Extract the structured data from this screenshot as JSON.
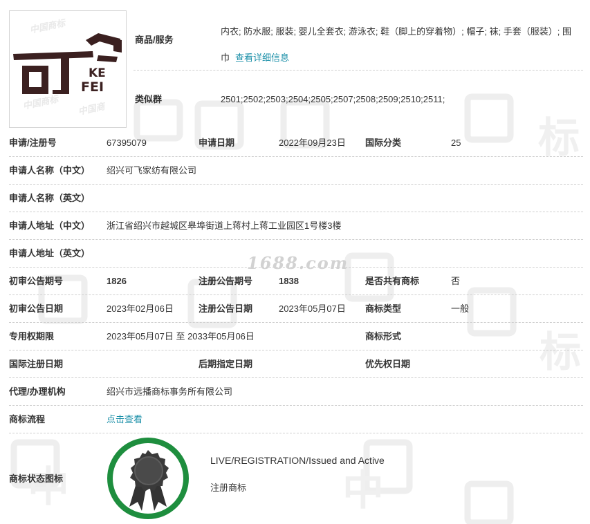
{
  "logo": {
    "icon": "trademark-logo-image",
    "text_top": "KE",
    "text_bottom": "FEI"
  },
  "goods": {
    "label": "商品/服务",
    "text": "内衣; 防水服; 服装; 婴儿全套衣; 游泳衣; 鞋（脚上的穿着物）; 帽子; 袜; 手套（服装）; 围巾",
    "link": "查看详细信息"
  },
  "similar": {
    "label": "类似群",
    "value": "2501;2502;2503;2504;2505;2507;2508;2509;2510;2511;"
  },
  "rows": {
    "reg_no": {
      "label": "申请/注册号",
      "value": "67395079"
    },
    "apply_date": {
      "label": "申请日期",
      "value": "2022年09月23日"
    },
    "intl_class": {
      "label": "国际分类",
      "value": "25"
    },
    "applicant_cn": {
      "label": "申请人名称（中文）",
      "value": "绍兴可飞家纺有限公司"
    },
    "applicant_en": {
      "label": "申请人名称（英文）",
      "value": ""
    },
    "address_cn": {
      "label": "申请人地址（中文）",
      "value": "浙江省绍兴市越城区皋埠街道上蒋村上蒋工业园区1号楼3楼"
    },
    "address_en": {
      "label": "申请人地址（英文）",
      "value": ""
    },
    "prelim_issue": {
      "label": "初审公告期号",
      "value": "1826"
    },
    "reg_issue": {
      "label": "注册公告期号",
      "value": "1838"
    },
    "shared": {
      "label": "是否共有商标",
      "value": "否"
    },
    "prelim_date": {
      "label": "初审公告日期",
      "value": "2023年02月06日"
    },
    "reg_date": {
      "label": "注册公告日期",
      "value": "2023年05月07日"
    },
    "tm_type": {
      "label": "商标类型",
      "value": "一般"
    },
    "exclusive": {
      "label": "专用权期限",
      "value": "2023年05月07日 至 2033年05月06日"
    },
    "tm_form": {
      "label": "商标形式",
      "value": ""
    },
    "intl_reg_date": {
      "label": "国际注册日期",
      "value": ""
    },
    "later_date": {
      "label": "后期指定日期",
      "value": ""
    },
    "priority_date": {
      "label": "优先权日期",
      "value": ""
    },
    "agent": {
      "label": "代理/办理机构",
      "value": "绍兴市远播商标事务所有限公司"
    },
    "process": {
      "label": "商标流程",
      "value": "点击查看"
    },
    "status": {
      "label": "商标状态图标",
      "status_en": "LIVE/REGISTRATION/Issued and Active",
      "status_cn": "注册商标"
    }
  },
  "watermarks": {
    "site": "1688.com",
    "text_a": "中国商标"
  },
  "colors": {
    "link": "#1a8fa8",
    "badge_ring": "#1e8e3e",
    "badge_medal": "#3a3a3a"
  },
  "icons": {
    "status": "registered-award-icon"
  }
}
